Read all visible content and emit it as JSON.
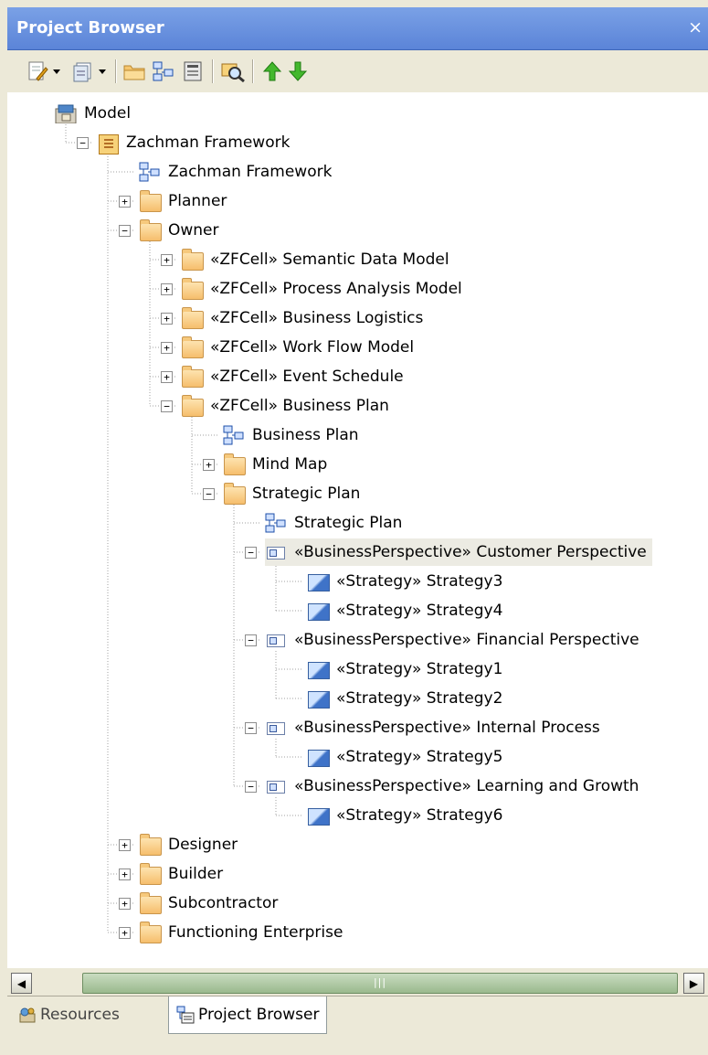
{
  "window": {
    "title": "Project Browser",
    "close_glyph": "×"
  },
  "toolbar": {
    "icons": [
      "new-element-icon",
      "dropdown-arrow-icon",
      "element-list-icon",
      "dropdown-arrow-icon",
      "folder-icon",
      "diagram-icon",
      "properties-icon",
      "find-icon",
      "move-up-icon",
      "move-down-icon"
    ]
  },
  "tree": {
    "rows": [
      {
        "label": "Model",
        "icon": "model-icon",
        "depth": 0,
        "expander": "none"
      },
      {
        "label": "Zachman Framework",
        "icon": "package-icon",
        "depth": 1,
        "expander": "minus"
      },
      {
        "label": "Zachman Framework",
        "icon": "diagram-icon",
        "depth": 2,
        "expander": "none"
      },
      {
        "label": "Planner",
        "icon": "folder-icon",
        "depth": 2,
        "expander": "plus"
      },
      {
        "label": "Owner",
        "icon": "folder-icon",
        "depth": 2,
        "expander": "minus"
      },
      {
        "label": "«ZFCell» Semantic Data Model",
        "icon": "folder-icon",
        "depth": 3,
        "expander": "plus"
      },
      {
        "label": "«ZFCell» Process Analysis Model",
        "icon": "folder-icon",
        "depth": 3,
        "expander": "plus"
      },
      {
        "label": "«ZFCell» Business Logistics",
        "icon": "folder-icon",
        "depth": 3,
        "expander": "plus"
      },
      {
        "label": "«ZFCell» Work Flow Model",
        "icon": "folder-icon",
        "depth": 3,
        "expander": "plus"
      },
      {
        "label": "«ZFCell» Event Schedule",
        "icon": "folder-icon",
        "depth": 3,
        "expander": "plus"
      },
      {
        "label": "«ZFCell» Business Plan",
        "icon": "folder-icon",
        "depth": 3,
        "expander": "minus"
      },
      {
        "label": "Business Plan",
        "icon": "diagram-icon",
        "depth": 4,
        "expander": "none"
      },
      {
        "label": "Mind Map",
        "icon": "folder-icon",
        "depth": 4,
        "expander": "plus"
      },
      {
        "label": "Strategic Plan",
        "icon": "folder-icon",
        "depth": 4,
        "expander": "minus"
      },
      {
        "label": "Strategic Plan",
        "icon": "diagram-icon",
        "depth": 5,
        "expander": "none"
      },
      {
        "label": "«BusinessPerspective» Customer Perspective",
        "icon": "element-icon",
        "depth": 5,
        "expander": "minus",
        "selected": true
      },
      {
        "label": "«Strategy» Strategy3",
        "icon": "strategy-icon",
        "depth": 6,
        "expander": "none"
      },
      {
        "label": "«Strategy» Strategy4",
        "icon": "strategy-icon",
        "depth": 6,
        "expander": "none"
      },
      {
        "label": "«BusinessPerspective» Financial Perspective",
        "icon": "element-icon",
        "depth": 5,
        "expander": "minus"
      },
      {
        "label": "«Strategy» Strategy1",
        "icon": "strategy-icon",
        "depth": 6,
        "expander": "none"
      },
      {
        "label": "«Strategy» Strategy2",
        "icon": "strategy-icon",
        "depth": 6,
        "expander": "none"
      },
      {
        "label": "«BusinessPerspective» Internal Process",
        "icon": "element-icon",
        "depth": 5,
        "expander": "minus"
      },
      {
        "label": "«Strategy» Strategy5",
        "icon": "strategy-icon",
        "depth": 6,
        "expander": "none"
      },
      {
        "label": "«BusinessPerspective» Learning and Growth",
        "icon": "element-icon",
        "depth": 5,
        "expander": "minus"
      },
      {
        "label": "«Strategy» Strategy6",
        "icon": "strategy-icon",
        "depth": 6,
        "expander": "none"
      },
      {
        "label": "Designer",
        "icon": "folder-icon",
        "depth": 2,
        "expander": "plus"
      },
      {
        "label": "Builder",
        "icon": "folder-icon",
        "depth": 2,
        "expander": "plus"
      },
      {
        "label": "Subcontractor",
        "icon": "folder-icon",
        "depth": 2,
        "expander": "plus"
      },
      {
        "label": "Functioning Enterprise",
        "icon": "folder-icon",
        "depth": 2,
        "expander": "plus"
      }
    ]
  },
  "scrollbar": {
    "left_glyph": "◀",
    "right_glyph": "▶",
    "grip": "|||"
  },
  "tabs": [
    {
      "label": "Resources",
      "icon": "resources-icon",
      "active": false
    },
    {
      "label": "Project Browser",
      "icon": "project-browser-icon",
      "active": true
    }
  ],
  "colors": {
    "title_bar": "#6b93dc",
    "selection": "#ecebe3",
    "scroll_thumb": "#a8c59a"
  }
}
